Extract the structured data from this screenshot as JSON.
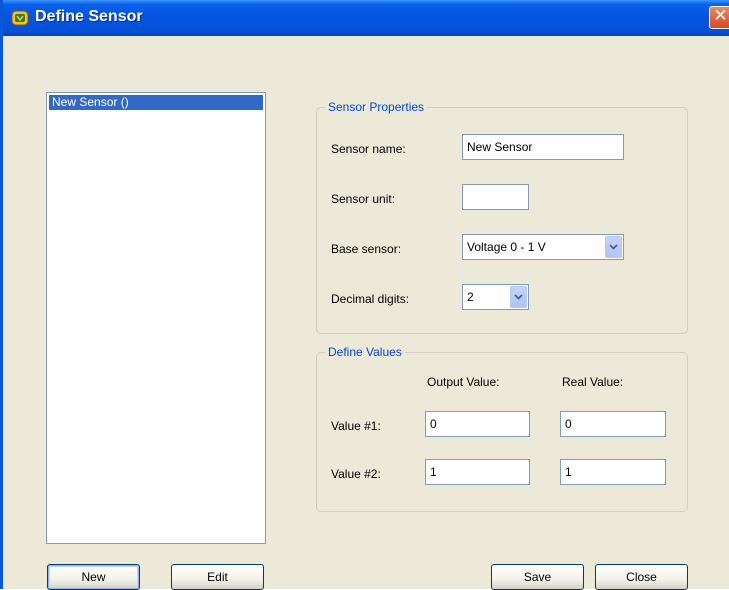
{
  "window": {
    "title": "Define Sensor",
    "close_glyph": "✕",
    "title_icon": "app-icon"
  },
  "sensor_list": {
    "items": [
      "New Sensor ()"
    ],
    "selected_index": 0
  },
  "sensor_properties": {
    "legend": "Sensor Properties",
    "name_label": "Sensor name:",
    "name_value": "New Sensor",
    "unit_label": "Sensor unit:",
    "unit_value": "",
    "base_label": "Base sensor:",
    "base_value": "Voltage 0 - 1 V",
    "decimal_label": "Decimal digits:",
    "decimal_value": "2"
  },
  "define_values": {
    "legend": "Define Values",
    "output_header": "Output Value:",
    "real_header": "Real Value:",
    "rows": [
      {
        "label": "Value #1:",
        "output": "0",
        "real": "0"
      },
      {
        "label": "Value #2:",
        "output": "1",
        "real": "1"
      }
    ]
  },
  "buttons": {
    "new": "New",
    "edit": "Edit",
    "save": "Save",
    "close": "Close"
  },
  "colors": {
    "title_bar": "#0554e0",
    "selection": "#316ac5",
    "group_label": "#0046d5",
    "dialog_bg": "#ece9d8"
  }
}
